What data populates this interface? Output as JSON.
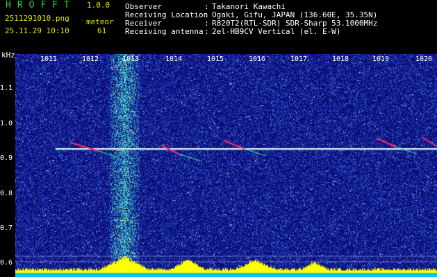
{
  "header": {
    "app_title": "HROFFT",
    "version": "1.0.0",
    "filename": "2511291010.png",
    "meteor_label": "meteor",
    "datetime": "25.11.29 10:10",
    "meteor_count": "61",
    "info": [
      {
        "label": "Observer",
        "value": "Takanori Kawachi"
      },
      {
        "label": "Receiving Location",
        "value": "Ogaki, Gifu, JAPAN (136.60E, 35.35N)"
      },
      {
        "label": "Receiver",
        "value": "R820T2(RTL-SDR) SDR-Sharp 53.1000MHz"
      },
      {
        "label": "Receiving antenna",
        "value": "2el-HB9CV Vertical (el. E-W)"
      }
    ]
  },
  "axes": {
    "y_unit": "kHz",
    "y_ticks": [
      "1.1",
      "1.0",
      "0.9",
      "0.8",
      "0.7",
      "0.6"
    ],
    "x_ticks": [
      "1011",
      "1012",
      "1013",
      "1014",
      "1015",
      "1016",
      "1017",
      "1018",
      "1019",
      "1020"
    ]
  },
  "colors": {
    "background": "#0a0a6e",
    "noise": "#2a55c8",
    "signal": "#f0f0ff",
    "meteor_head": "#ff3060",
    "interference": "#30ffa0",
    "amplitude": "#ffff00",
    "baseline": "#00c8ff"
  }
}
